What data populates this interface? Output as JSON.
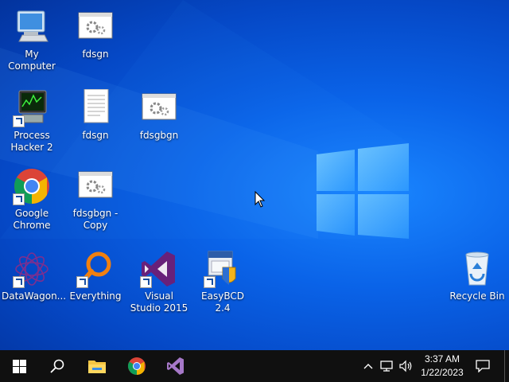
{
  "desktop": {
    "icons": [
      {
        "label": "My Computer",
        "icon": "monitor-icon"
      },
      {
        "label": "fdsgn",
        "icon": "settings-file-icon"
      },
      {
        "label": "Process Hacker 2",
        "icon": "process-hacker-icon"
      },
      {
        "label": "fdsgn",
        "icon": "text-file-icon"
      },
      {
        "label": "fdsgbgn",
        "icon": "settings-file-icon"
      },
      {
        "label": "Google Chrome",
        "icon": "chrome-icon"
      },
      {
        "label": "fdsgbgn - Copy",
        "icon": "settings-file-icon"
      },
      {
        "label": "DataWagon...",
        "icon": "datawagon-icon"
      },
      {
        "label": "Everything",
        "icon": "everything-search-icon"
      },
      {
        "label": "Visual Studio 2015",
        "icon": "visual-studio-icon"
      },
      {
        "label": "EasyBCD 2.4",
        "icon": "easybcd-icon"
      },
      {
        "label": "Recycle Bin",
        "icon": "recycle-bin-icon"
      }
    ]
  },
  "taskbar": {
    "pinned": [
      "start-icon",
      "search-icon",
      "file-explorer-icon",
      "chrome-icon",
      "visual-studio-icon"
    ],
    "tray": [
      "chevron-up-icon",
      "network-icon",
      "volume-icon"
    ],
    "clock": {
      "time": "3:37 AM",
      "date": "1/22/2023"
    },
    "notification": "action-center-icon"
  },
  "colors": {
    "desktop": "#0a63e8",
    "taskbar": "#101010",
    "accent": "#1a86ff"
  }
}
